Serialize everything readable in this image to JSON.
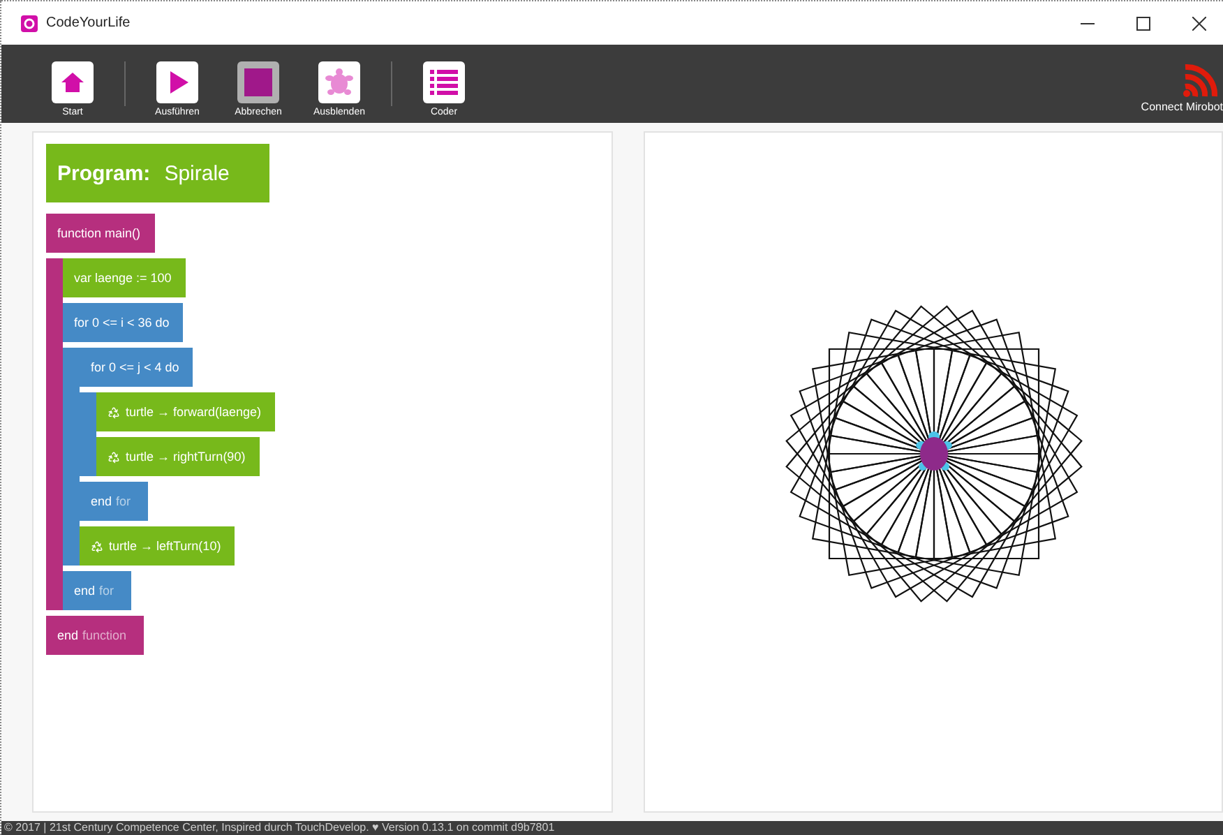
{
  "window": {
    "title": "CodeYourLife"
  },
  "toolbar": {
    "buttons": [
      {
        "label": "Start",
        "kind": "home",
        "active": false
      },
      {
        "label": "Ausführen",
        "kind": "play",
        "active": false
      },
      {
        "label": "Abbrechen",
        "kind": "stop",
        "active": true
      },
      {
        "label": "Ausblenden",
        "kind": "turtle",
        "active": false
      },
      {
        "label": "Coder",
        "kind": "list",
        "active": false
      }
    ],
    "connect": {
      "label": "Connect Mirobot"
    }
  },
  "program": {
    "label": "Program:",
    "name": "Spirale"
  },
  "code": [
    {
      "kind": "function",
      "text": "function main()",
      "end": "end",
      "end_keyword": "function",
      "children": [
        {
          "kind": "statement",
          "text": "var laenge := 100"
        },
        {
          "kind": "loop",
          "text": "for 0 <= i < 36 do",
          "end": "end",
          "end_keyword": "for",
          "children": [
            {
              "kind": "loop",
              "text": "for 0 <= j < 4 do",
              "end": "end",
              "end_keyword": "for",
              "children": [
                {
                  "kind": "call",
                  "text": "turtle → forward(laenge)"
                },
                {
                  "kind": "call",
                  "text": "turtle → rightTurn(90)"
                }
              ]
            },
            {
              "kind": "call",
              "text": "turtle → leftTurn(10)"
            }
          ]
        }
      ]
    }
  ],
  "footer": {
    "text": "© 2017 | 21st Century Competence Center, Inspired durch TouchDevelop. ♥ Version 0.13.1 on commit d9b7801"
  }
}
